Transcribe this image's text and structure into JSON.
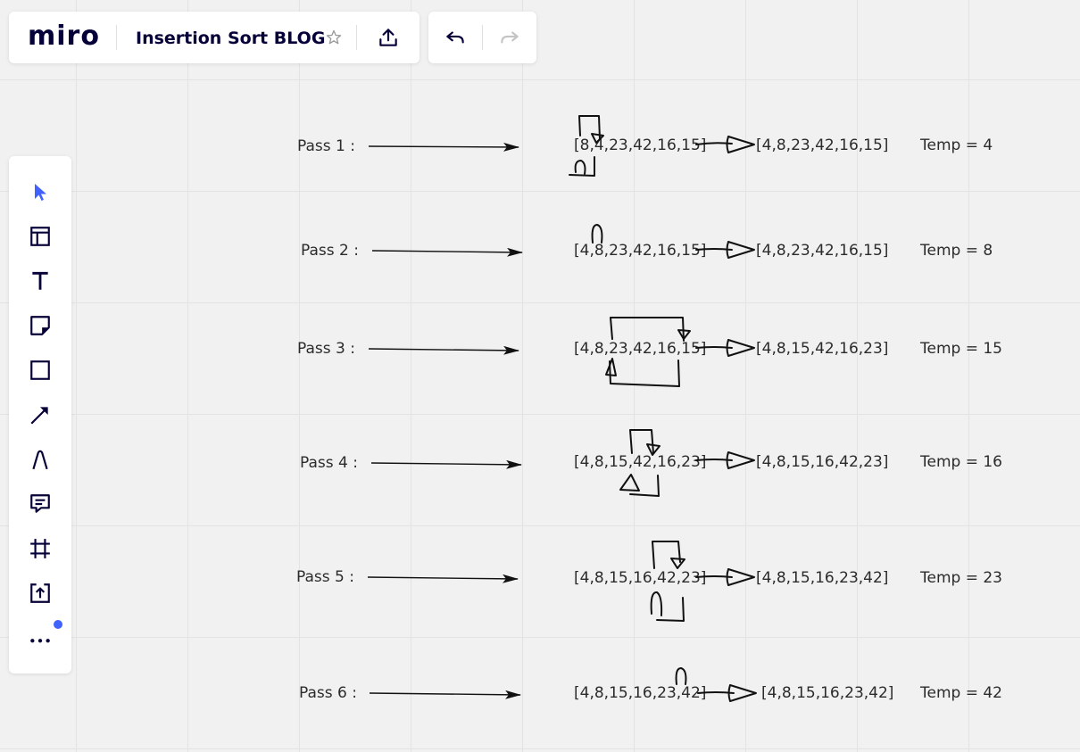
{
  "app": {
    "logo": "miro",
    "board_title": "Insertion Sort BLOG",
    "accent_color": "#4262ff"
  },
  "top_bar": {
    "icons": [
      "star-icon",
      "upload-icon"
    ],
    "undo_icons": [
      "undo-icon",
      "redo-icon"
    ]
  },
  "toolbar": {
    "tools": [
      "select-cursor-icon",
      "templates-icon",
      "text-icon",
      "sticky-note-icon",
      "shape-icon",
      "arrow-line-icon",
      "pen-icon",
      "comment-icon",
      "frame-icon",
      "upload-icon",
      "more-icon"
    ]
  },
  "passes": [
    {
      "label": "Pass 1 :",
      "before": "[8,4,23,42,16,15]",
      "after": "[4,8,23,42,16,15]",
      "temp": "Temp = 4"
    },
    {
      "label": "Pass 2 :",
      "before": "[4,8,23,42,16,15]",
      "after": "[4,8,23,42,16,15]",
      "temp": "Temp = 8"
    },
    {
      "label": "Pass 3 :",
      "before": "[4,8,23,42,16,15]",
      "after": "[4,8,15,42,16,23]",
      "temp": "Temp = 15"
    },
    {
      "label": "Pass 4 :",
      "before": "[4,8,15,42,16,23]",
      "after": "[4,8,15,16,42,23]",
      "temp": "Temp = 16"
    },
    {
      "label": "Pass 5 :",
      "before": "[4,8,15,16,42,23]",
      "after": "[4,8,15,16,23,42]",
      "temp": "Temp = 23"
    },
    {
      "label": "Pass 6 :",
      "before": "[4,8,15,16,23,42]",
      "after": "[4,8,15,16,23,42]",
      "temp": "Temp = 42"
    }
  ]
}
